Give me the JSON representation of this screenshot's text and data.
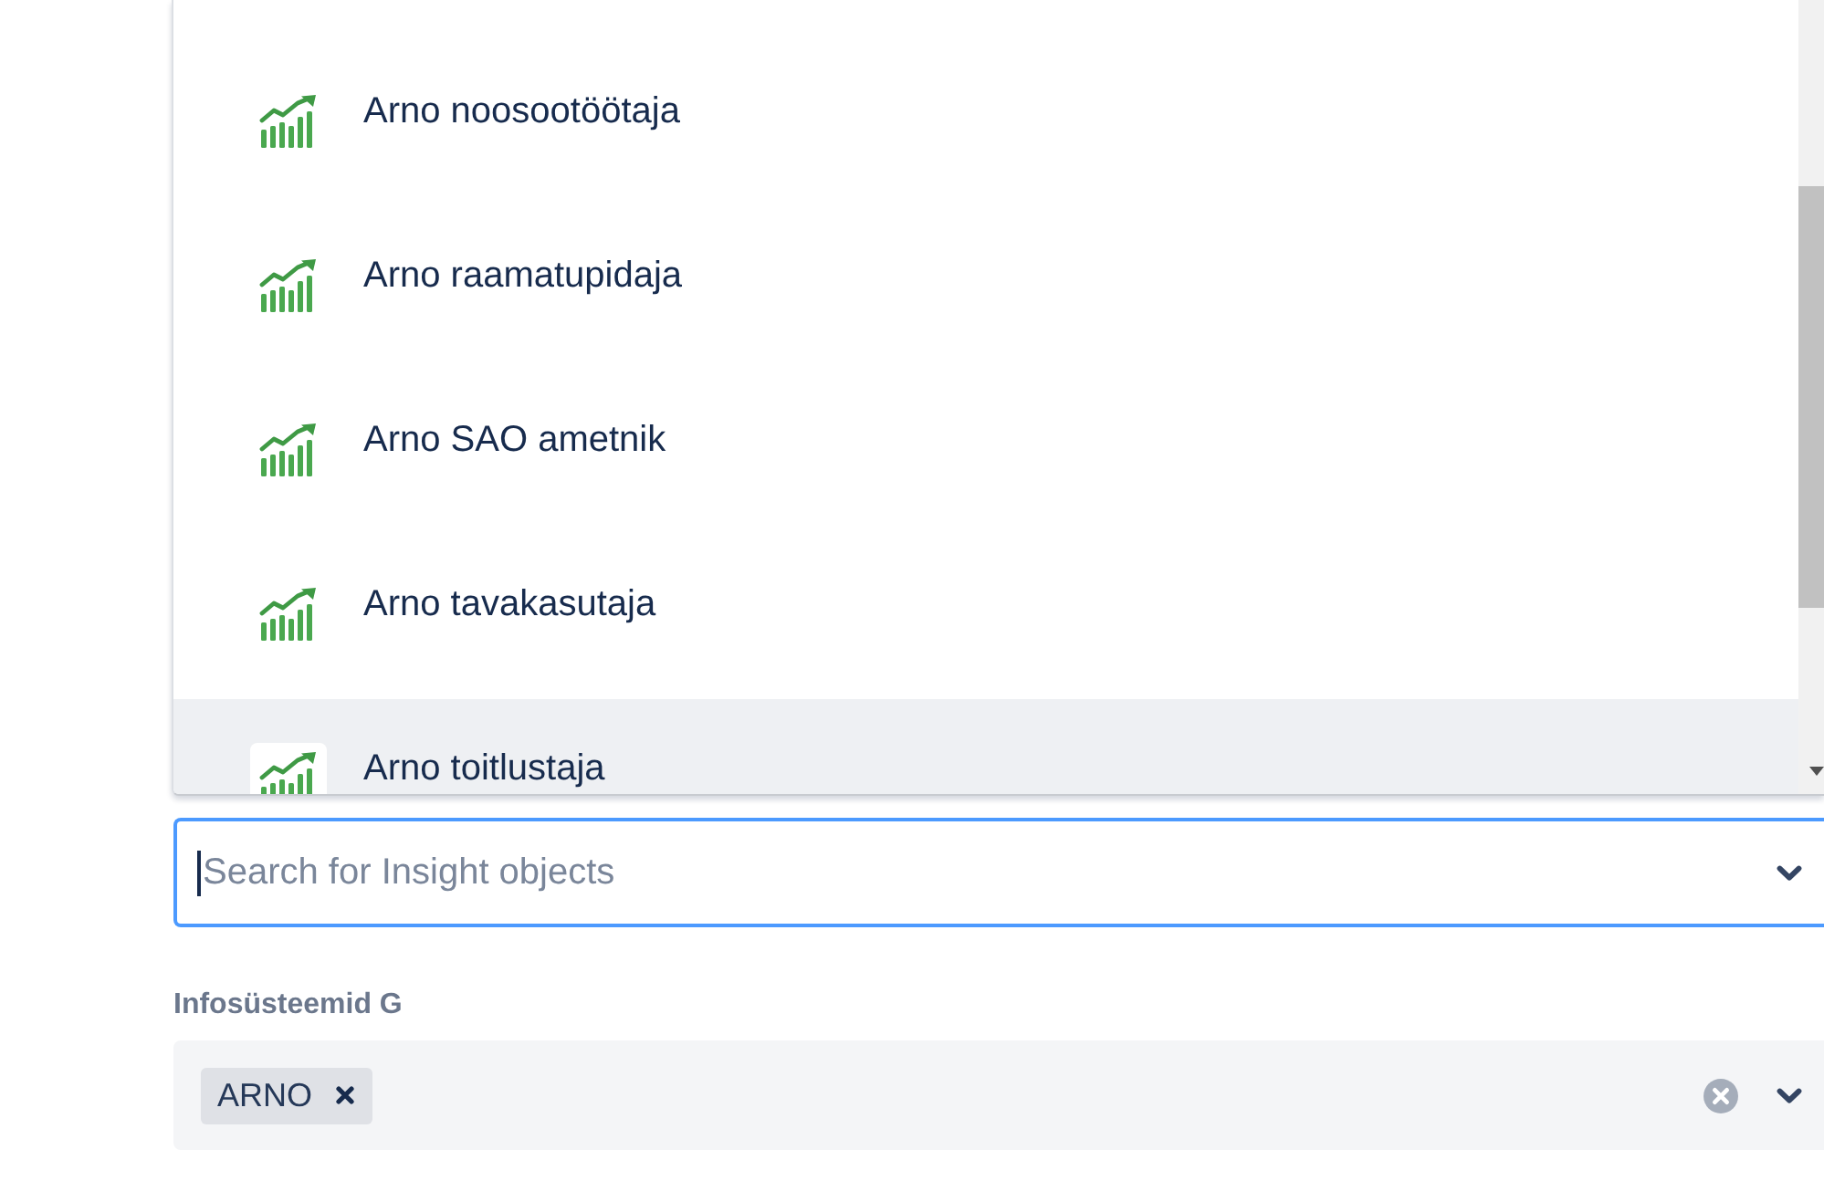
{
  "dropdown": {
    "options": [
      {
        "label": "Arno noosootöötaja",
        "selected": false
      },
      {
        "label": "Arno raamatupidaja",
        "selected": false
      },
      {
        "label": "Arno SAO ametnik",
        "selected": false
      },
      {
        "label": "Arno tavakasutaja",
        "selected": false
      },
      {
        "label": "Arno toitlustaja",
        "selected": true
      }
    ]
  },
  "search_field": {
    "placeholder": "Search for Insight objects",
    "focused": true
  },
  "field": {
    "label": "Infosüsteemid G",
    "tags": [
      {
        "label": "ARNO"
      }
    ]
  }
}
